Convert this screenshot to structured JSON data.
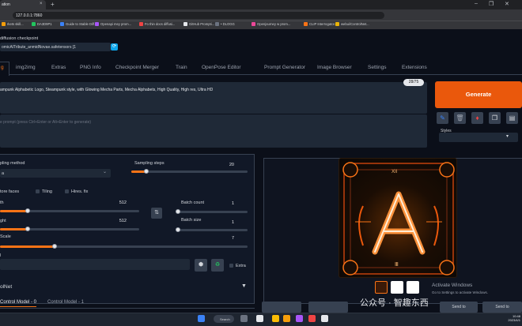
{
  "browser": {
    "tab_title": "ation",
    "tab_close": "×",
    "new_tab": "+",
    "url": "127.0.0.1:7860",
    "window_controls": [
      "‒",
      "❐",
      "✕"
    ],
    "bookmarks": [
      {
        "label": "rkets skill...",
        "color": "#f59e0b"
      },
      {
        "label": "DA3D9P1",
        "color": "#22c55e"
      },
      {
        "label": "Guide to Stable Diff...",
        "color": "#3b82f6"
      },
      {
        "label": "Openapi mey prom...",
        "color": "#a855f7"
      },
      {
        "label": "Fo thin docs diffusi...",
        "color": "#ef4444"
      },
      {
        "label": "GitHub Prompti...",
        "color": "#e5e7eb"
      },
      {
        "label": "• DLOGG",
        "color": "#6b7280"
      },
      {
        "label": "Openjourney w prom...",
        "color": "#ec4899"
      },
      {
        "label": "CLIP Interrogator...",
        "color": "#f97316"
      },
      {
        "label": "webui/ControlNet...",
        "color": "#eab308"
      }
    ]
  },
  "app": {
    "checkpoint_label": "diffusion checkpoint",
    "checkpoint_value": "omicAlTribute_anmidNovae.safetensors [1",
    "checkpoint_refresh_icon": "refresh-icon",
    "tabs": [
      "g",
      "img2img",
      "Extras",
      "PNG Info",
      "Checkpoint Merger",
      "Train",
      "OpenPose Editor",
      "Prompt Generator",
      "Image Browser",
      "Settings",
      "Extensions"
    ],
    "prompt": "ampunk Alphabetic Logo, Steampunk style, with Glowing Mecha Parts, Mecha Alphabets, High Quality, High res, Ultra HD",
    "token_count": "28/75",
    "negative_placeholder": "e prompt (press Ctrl+Enter or Alt+Enter to generate)",
    "generate_label": "Generate",
    "style_buttons": [
      {
        "icon": "paint-icon",
        "glyph": "✎",
        "color": "#3b82f6"
      },
      {
        "icon": "trash-icon",
        "glyph": "🗑",
        "color": "#9ca3af"
      },
      {
        "icon": "style-apply-icon",
        "glyph": "♦",
        "color": "#ef4444"
      },
      {
        "icon": "clipboard-icon",
        "glyph": "❐",
        "color": "#e5e7eb"
      },
      {
        "icon": "save-style-icon",
        "glyph": "▤",
        "color": "#d1d5db"
      }
    ],
    "styles_label": "Styles",
    "styles_caret": "▾"
  },
  "params": {
    "sampling_method_label": "pling method",
    "sampler_value": "a",
    "sampling_steps_label": "Sampling steps",
    "sampling_steps_value": "20",
    "restore_faces_label": "tore faces",
    "tiling_label": "Tiling",
    "hires_label": "Hires. fix",
    "width_label": "th",
    "width_value": "512",
    "height_label": "ght",
    "height_value": "512",
    "batch_count_label": "Batch count",
    "batch_count_value": "1",
    "batch_size_label": "Batch size",
    "batch_size_value": "1",
    "cfg_label": "Scale",
    "cfg_value": "7",
    "seed_label": "l",
    "extra_label": "Extra",
    "swap_icon": "⇅",
    "dice_icon": "⬢",
    "recycle_icon": "♻",
    "controlnet_label": "olNet",
    "controlnet_caret": "▼",
    "controlnet_tabs": [
      "Control Model - 0",
      "Control Model - 1"
    ]
  },
  "output": {
    "logo_letter": "A",
    "logo_small_text": "XII",
    "logo_bottom": "Ⅲ",
    "output_buttons": [
      "",
      "",
      "Send to",
      "Send to"
    ],
    "activate_line1": "Activate Windows",
    "activate_line2": "Go to Settings to activate Windows.",
    "watermark": "公众号 · 智趣东西"
  },
  "taskbar": {
    "search_label": "Search",
    "time": "10:48",
    "date": "2023/4/1",
    "icons": [
      {
        "name": "windows-start-icon",
        "color": "#3b82f6"
      },
      {
        "name": "files-icon",
        "color": "#6b7280"
      },
      {
        "name": "media-icon",
        "color": "#e5e7eb"
      },
      {
        "name": "chrome-icon",
        "color": "#fbbc04"
      },
      {
        "name": "folder-icon",
        "color": "#f59e0b"
      },
      {
        "name": "app-icon",
        "color": "#a855f7"
      },
      {
        "name": "opera-icon",
        "color": "#ef4444"
      },
      {
        "name": "mail-icon",
        "color": "#e5e7eb"
      }
    ]
  },
  "colors": {
    "accent": "#ea580c",
    "slider_fill": "#f97316",
    "panel": "#111827",
    "background": "#0b0f19"
  },
  "levels": {
    "sampling_steps_fraction": 0.13,
    "width_fraction": 0.2,
    "height_fraction": 0.2,
    "batch_count_fraction": 0.02,
    "batch_size_fraction": 0.02,
    "cfg_fraction": 0.22
  }
}
